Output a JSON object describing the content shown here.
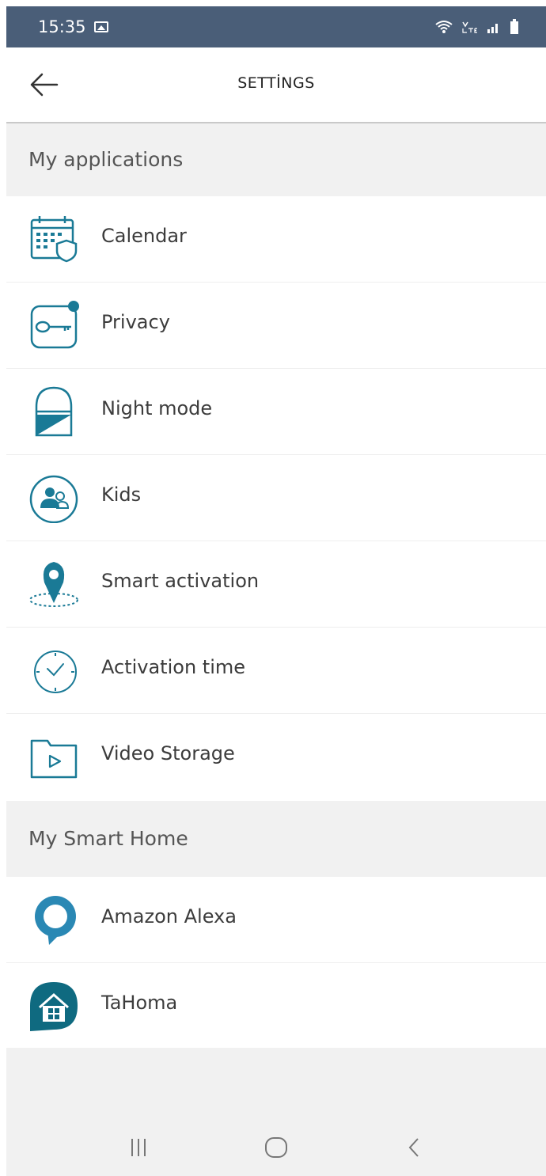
{
  "status_bar": {
    "time": "15:35",
    "lte_label": "Vo)\nLTE"
  },
  "header": {
    "title": "SETTİNGS"
  },
  "sections": {
    "applications": {
      "title": "My applications",
      "items": [
        {
          "label": "Calendar",
          "icon": "calendar-shield-icon"
        },
        {
          "label": "Privacy",
          "icon": "key-icon"
        },
        {
          "label": "Night mode",
          "icon": "night-mode-icon"
        },
        {
          "label": "Kids",
          "icon": "kids-icon"
        },
        {
          "label": "Smart activation",
          "icon": "location-pin-icon"
        },
        {
          "label": "Activation time",
          "icon": "clock-icon"
        },
        {
          "label": "Video Storage",
          "icon": "video-folder-icon"
        }
      ]
    },
    "smart_home": {
      "title": "My Smart Home",
      "items": [
        {
          "label": "Amazon Alexa",
          "icon": "alexa-icon"
        },
        {
          "label": "TaHoma",
          "icon": "tahoma-icon"
        }
      ]
    }
  },
  "colors": {
    "accent": "#1a7a96",
    "status_bar": "#4a5e78",
    "section_bg": "#f1f1f1"
  }
}
